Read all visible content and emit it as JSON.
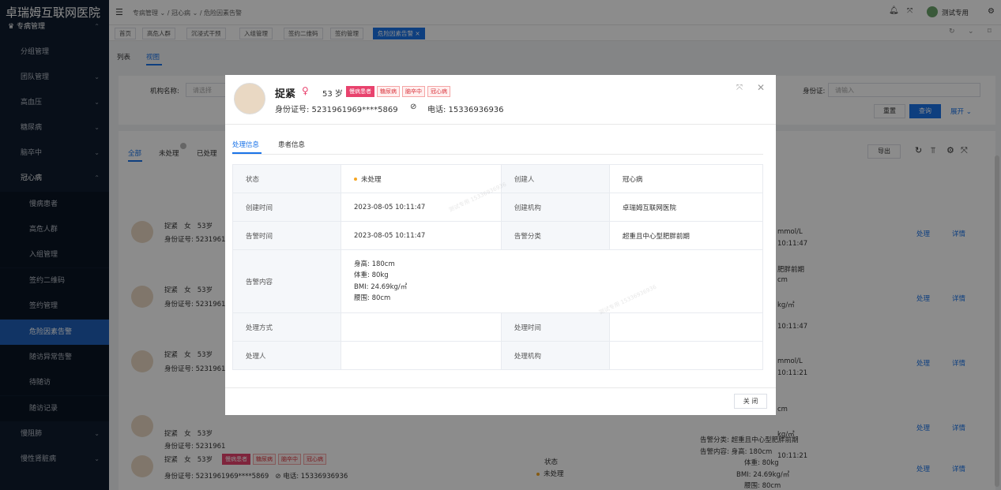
{
  "sidebar": {
    "brand": "卓瑞姆互联网医院",
    "group": "专病管理",
    "items": [
      "分组管理",
      "团队管理",
      "高血压",
      "糖尿病",
      "脑卒中",
      "冠心病"
    ],
    "sub_items": [
      "慢病患者",
      "高危人群",
      "入组管理",
      "签约二维码",
      "签约管理",
      "危险因素告警",
      "随访异常告警",
      "待随访",
      "随访记录"
    ],
    "bottom_items": [
      "慢阻肺",
      "慢性肾脏病"
    ]
  },
  "topbar": {
    "breadcrumb": [
      "专病管理",
      "冠心病",
      "危险因素告警"
    ],
    "user": "测试专用"
  },
  "tabs": [
    "首页",
    "高危人群",
    "沉浸式干预",
    "入组管理",
    "签约二维码",
    "签约管理",
    "危险因素告警"
  ],
  "view_tabs": [
    "列表",
    "视图"
  ],
  "filter": {
    "org_label": "机构名称:",
    "org_placeholder": "请选择",
    "id_label": "身份证:",
    "id_placeholder": "请输入",
    "reset": "重置",
    "search": "查询",
    "expand": "展开"
  },
  "status_tabs": [
    "全部",
    "未处理",
    "已处理"
  ],
  "export": "导出",
  "list": {
    "name": "捉紧",
    "gender": "女",
    "age": "53岁",
    "id_prefix": "身份证号: 5231961969****5869",
    "phone": "电话: 15336936936",
    "tags": [
      "慢病患者",
      "糖尿病",
      "脑卒中",
      "冠心病"
    ],
    "status_label": "状态",
    "status_value": "未处理",
    "action_handle": "处理",
    "action_detail": "详情",
    "row_truncated": "5231961",
    "frag_mmol": "mmol/L",
    "frag_time1": "10:11:47",
    "frag_time2": "10:11:21",
    "frag_cm": "cm",
    "frag_kg": "kg/㎡",
    "frag_rear": "肥胖前期",
    "last_alert_type": "告警分类: 超重且中心型肥胖前期",
    "last_alert_content": "告警内容: 身高: 180cm",
    "last_weight": "体重: 80kg",
    "last_bmi": "BMI: 24.69kg/㎡",
    "last_waist": "腰围: 80cm"
  },
  "modal": {
    "name": "捉紧",
    "age": "53 岁",
    "tags": [
      "慢病患者",
      "糖尿病",
      "脑卒中",
      "冠心病"
    ],
    "id": "身份证号: 5231961969****5869",
    "phone": "电话: 15336936936",
    "tab_active": "处理信息",
    "tab_other": "患者信息",
    "rows": {
      "status_label": "状态",
      "status_value": "未处理",
      "creator_label": "创建人",
      "creator_value": "冠心病",
      "ctime_label": "创建时间",
      "ctime_value": "2023-08-05 10:11:47",
      "corg_label": "创建机构",
      "corg_value": "卓瑞姆互联网医院",
      "atime_label": "告警时间",
      "atime_value": "2023-08-05 10:11:47",
      "acat_label": "告警分类",
      "acat_value": "超重且中心型肥胖前期",
      "content_label": "告警内容",
      "content_lines": [
        "身高: 180cm",
        "体重: 80kg",
        "BMI: 24.69kg/㎡",
        "腰围: 80cm"
      ],
      "method_label": "处理方式",
      "htime_label": "处理时间",
      "handler_label": "处理人",
      "horg_label": "处理机构"
    },
    "close": "关 闭",
    "watermark": "测试专用 15336936936"
  },
  "colors": {
    "primary": "#1a73e8",
    "sidebar_bg": "#0f1c2e",
    "tag_red": "#d9363e"
  }
}
